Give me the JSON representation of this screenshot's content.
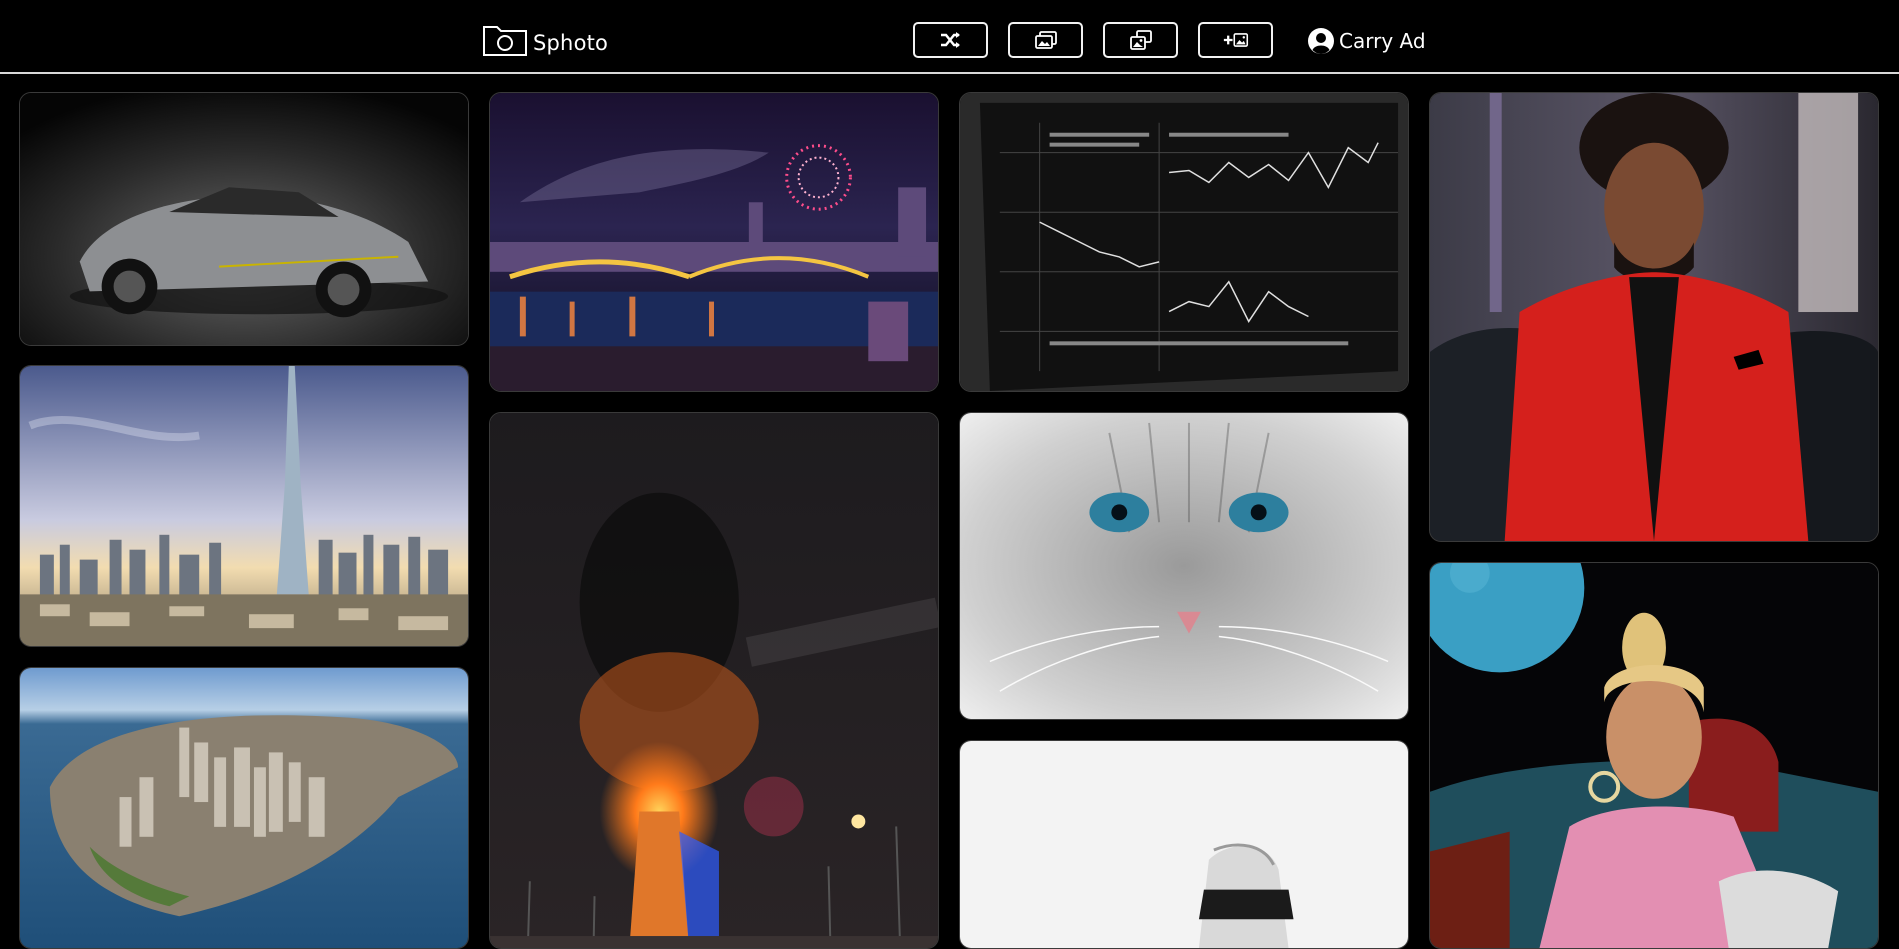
{
  "app": {
    "name": "Sphoto"
  },
  "navbar": {
    "buttons": [
      {
        "icon": "shuffle-icon"
      },
      {
        "icon": "gallery-icon"
      },
      {
        "icon": "collections-icon"
      },
      {
        "icon": "add-image-icon"
      }
    ],
    "user": {
      "name": "Carry Ad",
      "icon": "user-circle-icon"
    }
  },
  "gallery": {
    "photos": [
      {
        "subject": "sports-car"
      },
      {
        "subject": "city-fireworks-night"
      },
      {
        "subject": "stock-trading-screen"
      },
      {
        "subject": "man-in-red-suit"
      },
      {
        "subject": "skyscraper-city"
      },
      {
        "subject": "fire-dragon-bridge-night"
      },
      {
        "subject": "blue-eyed-cat"
      },
      {
        "subject": "white-sneaker"
      },
      {
        "subject": "city-aerial-waterfront"
      },
      {
        "subject": "woman-pink-jacket-blue-moon"
      }
    ]
  }
}
